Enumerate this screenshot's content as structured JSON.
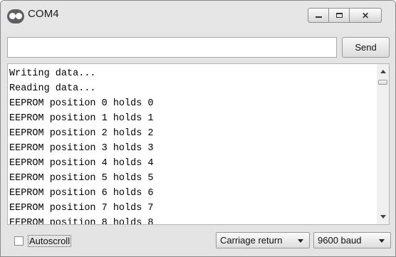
{
  "window": {
    "title": "COM4",
    "icon": "arduino-infinity-icon",
    "controls": [
      "minimize-icon",
      "maximize-icon",
      "close-icon"
    ]
  },
  "send_bar": {
    "input_value": "",
    "send_label": "Send"
  },
  "output": {
    "lines": [
      "Writing data...",
      "Reading data...",
      "EEPROM position 0 holds 0",
      "EEPROM position 1 holds 1",
      "EEPROM position 2 holds 2",
      "EEPROM position 3 holds 3",
      "EEPROM position 4 holds 4",
      "EEPROM position 5 holds 5",
      "EEPROM position 6 holds 6",
      "EEPROM position 7 holds 7",
      "EEPROM position 8 holds 8"
    ]
  },
  "footer": {
    "autoscroll_label": "Autoscroll",
    "autoscroll_checked": false,
    "line_ending": "Carriage return",
    "baud_rate": "9600 baud"
  }
}
